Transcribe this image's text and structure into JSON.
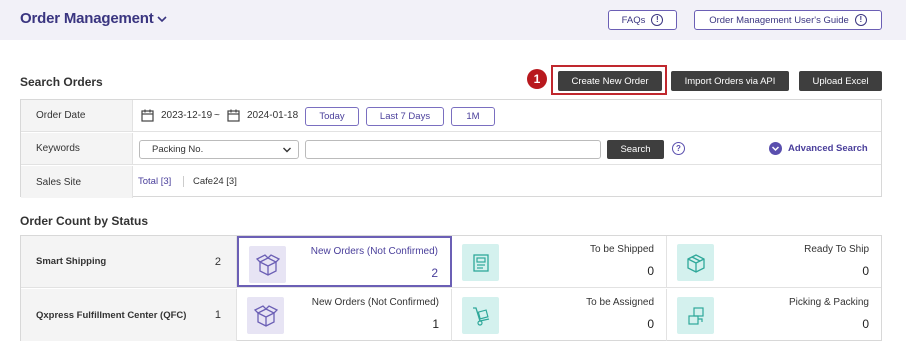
{
  "header": {
    "title": "Order Management",
    "faqs_label": "FAQs",
    "guide_label": "Order Management User's Guide"
  },
  "search": {
    "section_title": "Search Orders",
    "step_badge": "1",
    "buttons": {
      "create_new_order": "Create New Order",
      "import_orders_api": "Import Orders via API",
      "upload_excel": "Upload Excel"
    },
    "order_date": {
      "label": "Order Date",
      "start": "2023-12-19",
      "separator": "~",
      "end": "2024-01-18",
      "presets": [
        "Today",
        "Last 7 Days",
        "1M"
      ]
    },
    "keywords": {
      "label": "Keywords",
      "selected_option": "Packing No.",
      "input_value": "",
      "search_label": "Search",
      "help_label": "?",
      "advanced_label": "Advanced Search"
    },
    "sales_site": {
      "label": "Sales Site",
      "total_label": "Total [3]",
      "cafe24_label": "Cafe24 [3]"
    }
  },
  "status": {
    "section_title": "Order Count by Status",
    "rows": [
      {
        "label": "Smart Shipping",
        "count": "2",
        "cells": [
          {
            "name": "New Orders (Not Confirmed)",
            "value": "2",
            "icon": "open-box-icon",
            "selected": true
          },
          {
            "name": "To be Shipped",
            "value": "0",
            "icon": "shipping-label-icon"
          },
          {
            "name": "Ready To Ship",
            "value": "0",
            "icon": "package-icon"
          }
        ]
      },
      {
        "label": "Qxpress Fulfillment Center (QFC)",
        "count": "1",
        "cells": [
          {
            "name": "New Orders (Not Confirmed)",
            "value": "1",
            "icon": "open-box-icon"
          },
          {
            "name": "To be Assigned",
            "value": "0",
            "icon": "hand-truck-icon"
          },
          {
            "name": "Picking & Packing",
            "value": "0",
            "icon": "picking-boxes-icon"
          }
        ]
      }
    ]
  },
  "colors": {
    "accent_purple": "#4a3f9b",
    "highlight_red": "#c0282e",
    "teal_icon_bg": "#d4f1ee",
    "purple_icon_bg": "#e7e4f4"
  }
}
